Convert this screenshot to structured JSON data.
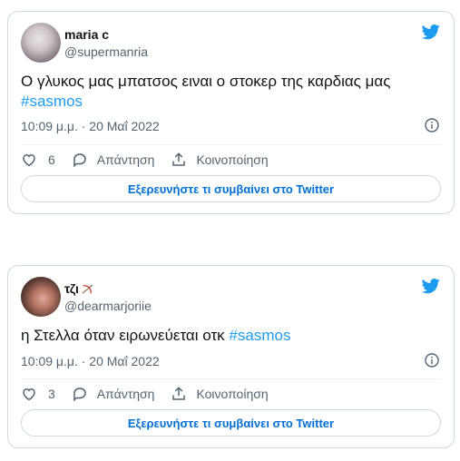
{
  "tweets": [
    {
      "name": "maria c",
      "handle": "@supermanria",
      "text": "Ο γλυκος μας μπατσος ειναι ο στοκερ της καρδιας μας",
      "hashtag": "#sasmos",
      "timestamp": "10:09 μ.μ. · 20 Μαΐ 2022",
      "likes": "6",
      "reply_label": "Απάντηση",
      "share_label": "Κοινοποίηση",
      "explore_label": "Εξερευνήστε τι συμβαίνει στο Twitter"
    },
    {
      "name": "τζι",
      "handle": "@dearmarjoriie",
      "text": "η Στελλα όταν ειρωνεύεται οτκ",
      "hashtag": "#sasmos",
      "timestamp": "10:09 μ.μ. · 20 Μαΐ 2022",
      "likes": "3",
      "reply_label": "Απάντηση",
      "share_label": "Κοινοποίηση",
      "explore_label": "Εξερευνήστε τι συμβαίνει στο Twitter"
    }
  ],
  "colors": {
    "accent": "#1d9bf0",
    "link_button": "#006fd6",
    "muted": "#536471",
    "border": "#cfd9de"
  },
  "icons": [
    "twitter-bird-icon",
    "info-icon",
    "heart-icon",
    "reply-icon",
    "share-icon",
    "bow-and-arrow-emoji"
  ]
}
